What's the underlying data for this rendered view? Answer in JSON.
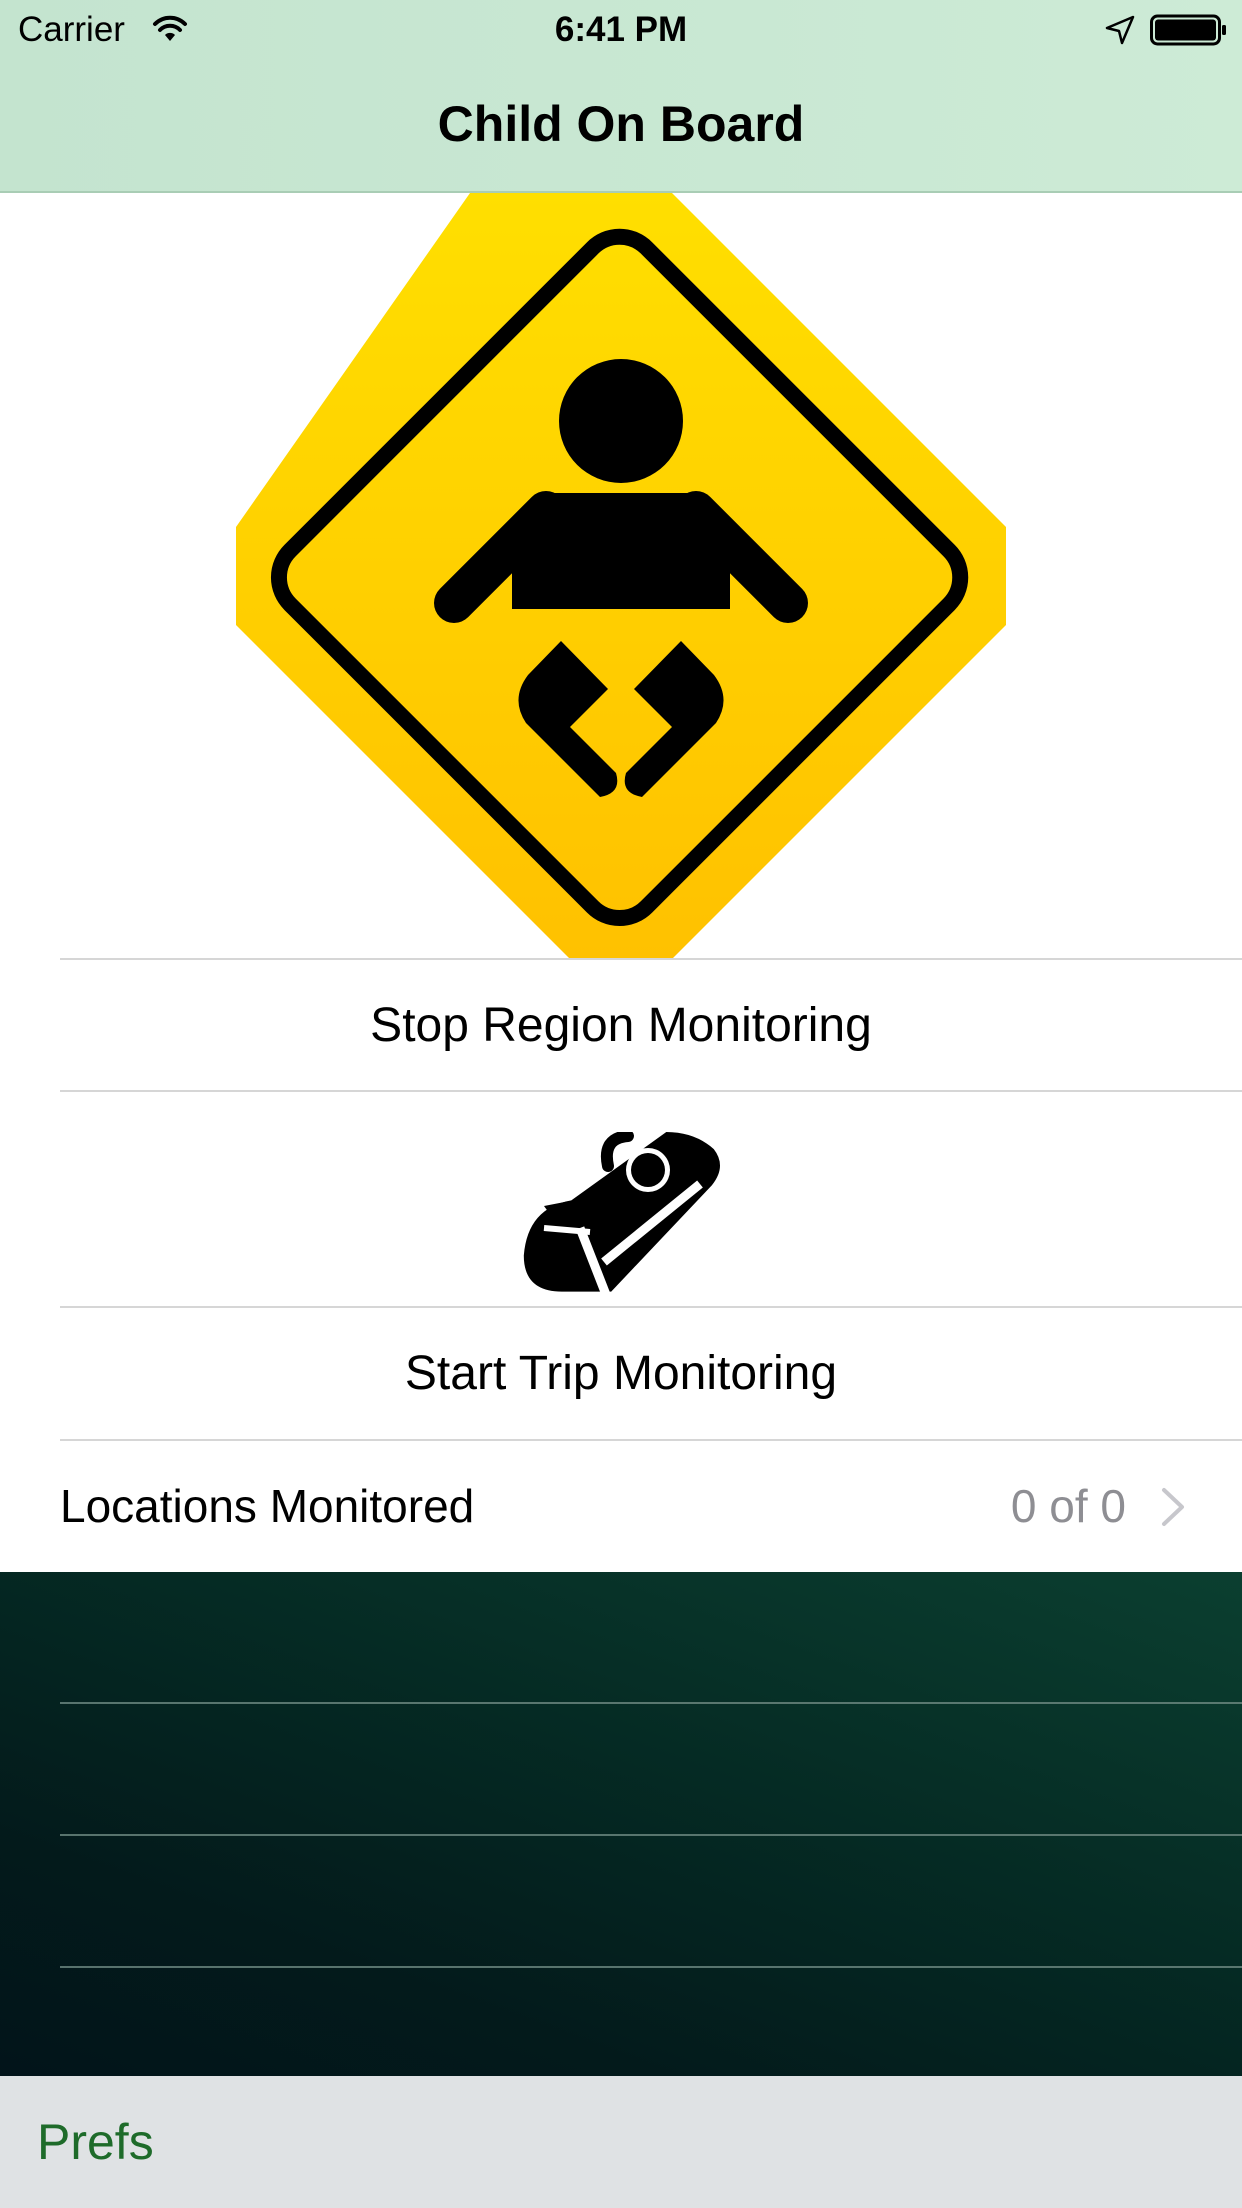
{
  "status_bar": {
    "carrier": "Carrier",
    "time": "6:41 PM",
    "icons": [
      "wifi-icon",
      "location-arrow-icon",
      "battery-icon"
    ]
  },
  "nav": {
    "title": "Child On Board"
  },
  "hero": {
    "icon": "baby-on-board-sign-icon"
  },
  "rows": {
    "stop_region": "Stop Region Monitoring",
    "carseat_icon": "car-seat-icon",
    "start_trip": "Start Trip Monitoring",
    "locations": {
      "label": "Locations Monitored",
      "value": "0 of 0"
    }
  },
  "toolbar": {
    "prefs_label": "Prefs"
  },
  "colors": {
    "nav_background": "#c9e8d3",
    "sign_yellow_top": "#ffdf00",
    "sign_yellow_bottom": "#ffc100",
    "dark_area": "#052b24",
    "toolbar_background": "#dfe2e4",
    "accent_green": "#1e6b2a",
    "secondary_text": "#8e8e93"
  }
}
